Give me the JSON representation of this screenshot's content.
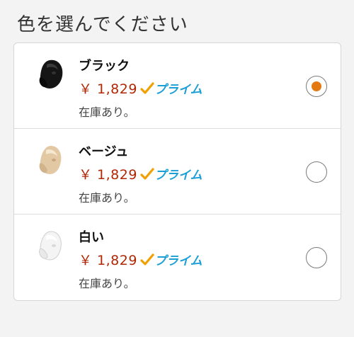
{
  "title": "色を選んでください",
  "options": [
    {
      "name": "ブラック",
      "price": "￥ 1,829",
      "prime": "プライム",
      "stock": "在庫あり。",
      "selected": true
    },
    {
      "name": "ベージュ",
      "price": "￥ 1,829",
      "prime": "プライム",
      "stock": "在庫あり。",
      "selected": false
    },
    {
      "name": "白い",
      "price": "￥ 1,829",
      "prime": "プライム",
      "stock": "在庫あり。",
      "selected": false
    }
  ],
  "colors": {
    "price": "#b12704",
    "prime_blue": "#1c9fd4",
    "prime_check": "#f0a000",
    "radio_selected": "#e47911"
  },
  "icons": [
    "earbud-black-image",
    "earbud-beige-image",
    "earbud-white-image",
    "prime-check-icon"
  ]
}
